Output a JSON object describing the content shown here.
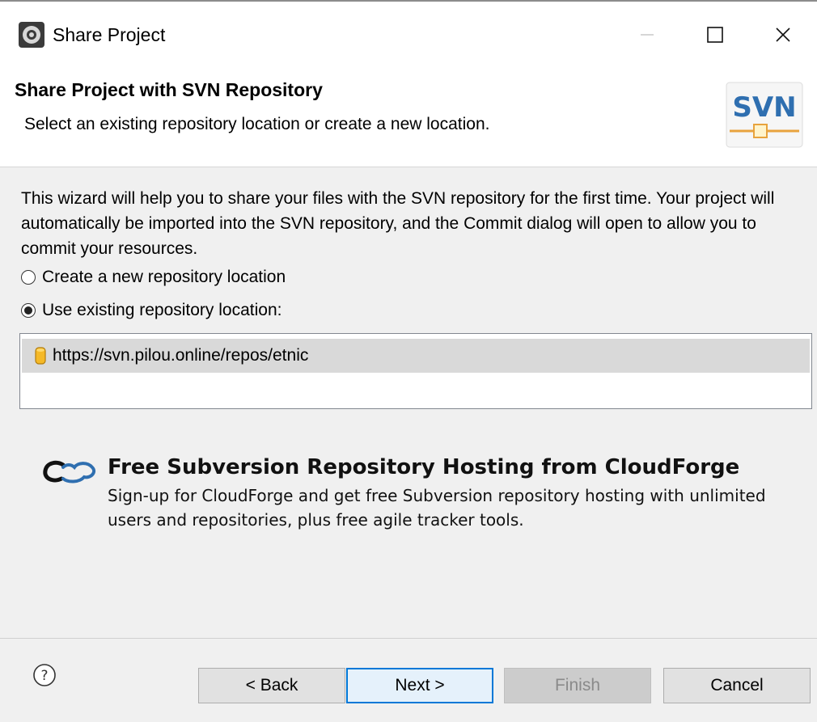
{
  "window": {
    "title": "Share Project",
    "icons": {
      "app": "eclipse-icon",
      "minimize": "minimize-icon",
      "maximize": "maximize-icon",
      "close": "close-icon"
    }
  },
  "banner": {
    "title": "Share Project with SVN Repository",
    "description": "Select an existing repository location or create a new location.",
    "logo_text": "SVN"
  },
  "main": {
    "intro": "This wizard will help you to share your files with the SVN repository for the first time. Your project will automatically be imported into the SVN repository, and the Commit dialog will open to allow you to commit your resources.",
    "options": [
      {
        "label": "Create a new repository location",
        "selected": false
      },
      {
        "label": "Use existing repository location:",
        "selected": true
      }
    ],
    "repositories": [
      {
        "url": "https://svn.pilou.online/repos/etnic",
        "icon": "repository-icon",
        "selected": true
      }
    ]
  },
  "promo": {
    "title": "Free Subversion Repository Hosting from CloudForge",
    "description": "Sign-up for CloudForge and get free Subversion repository hosting with unlimited users and repositories, plus free agile tracker tools.",
    "icon": "cloudforge-icon"
  },
  "footer": {
    "help_icon": "help-icon",
    "back_label": "< Back",
    "next_label": "Next >",
    "finish_label": "Finish",
    "cancel_label": "Cancel"
  },
  "colors": {
    "accent": "#0078d7",
    "svn_blue": "#2f6fb0",
    "svn_orange": "#e8a33d"
  }
}
